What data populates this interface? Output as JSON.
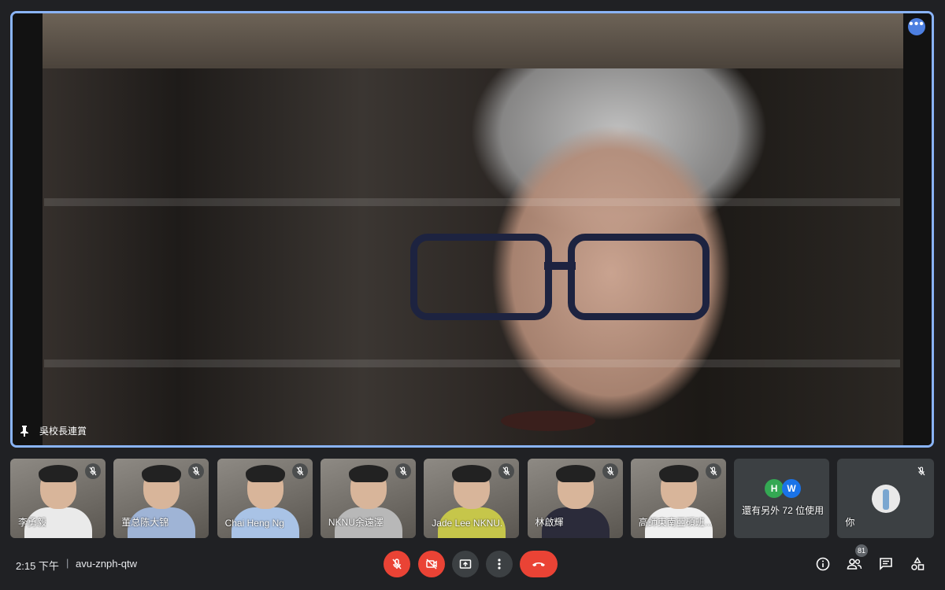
{
  "speaker": {
    "name": "吳校長連賞"
  },
  "participants": [
    {
      "name": "李勇毅",
      "shirt": "#eaeaea"
    },
    {
      "name": "董总陈大锦",
      "shirt": "#9fb4d6"
    },
    {
      "name": "Chai Heng Ng",
      "shirt": "#a9c3e6"
    },
    {
      "name": "NKNU余遠澤",
      "shirt": "#b8b8b8"
    },
    {
      "name": "Jade Lee NKNU.",
      "shirt": "#c6c64a"
    },
    {
      "name": "林啟輝",
      "shirt": "#2b2b3a"
    },
    {
      "name": "高師東南亞碩班...",
      "shirt": "#f0f0f0"
    }
  ],
  "others": {
    "avatars": [
      "H",
      "W"
    ],
    "label": "還有另外 72 位使用者"
  },
  "you": {
    "label": "你"
  },
  "bottom": {
    "time": "2:15 下午",
    "separator": "|",
    "meeting_code": "avu-znph-qtw",
    "people_count": "81"
  },
  "colors": {
    "accent": "#8ab4f8",
    "danger": "#ea4335",
    "surface": "#3c4043",
    "background": "#202124"
  }
}
